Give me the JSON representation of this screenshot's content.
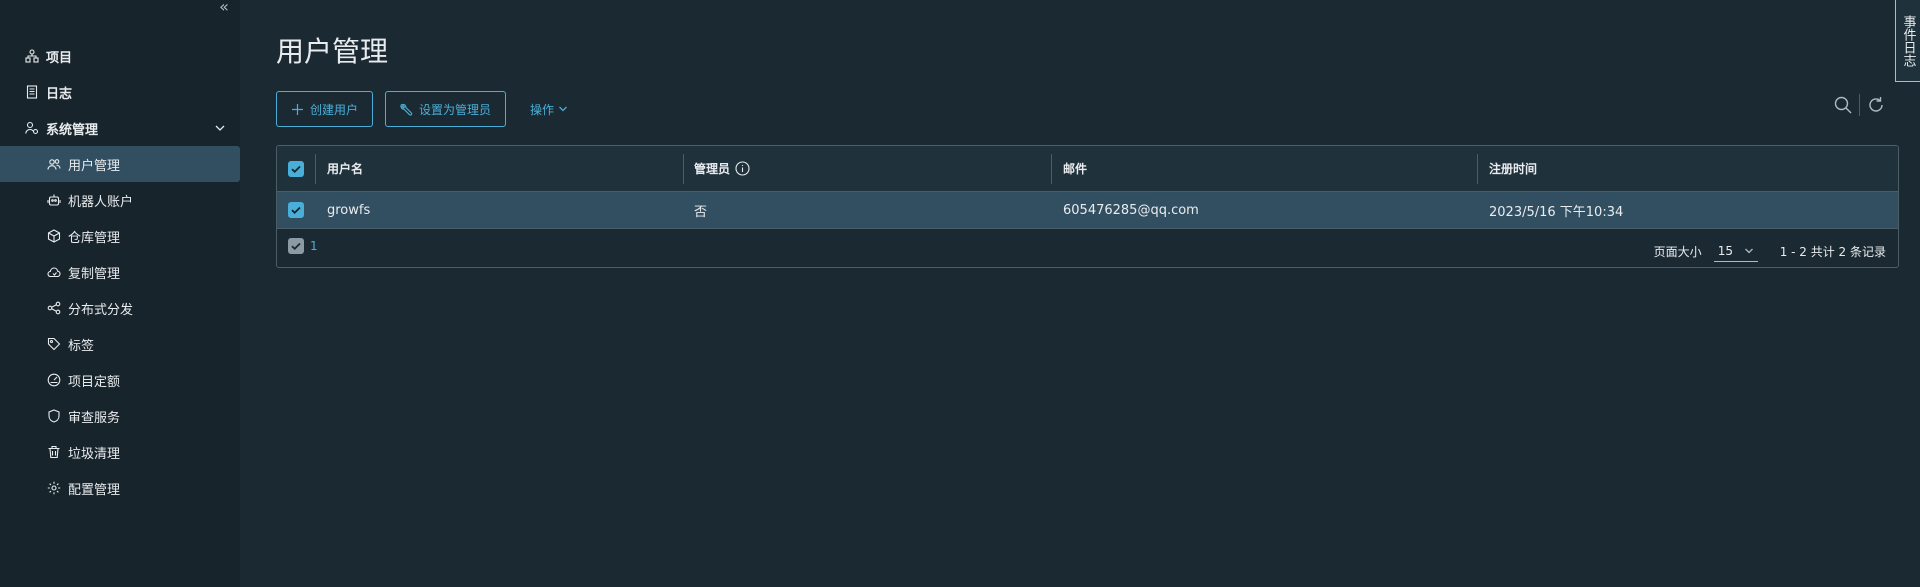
{
  "sidebar": {
    "collapse_glyph": "«",
    "items": [
      {
        "label": "项目",
        "icon": "project-icon"
      },
      {
        "label": "日志",
        "icon": "log-icon"
      },
      {
        "label": "系统管理",
        "icon": "system-admin-icon"
      },
      {
        "label": "用户管理",
        "icon": "users-icon"
      },
      {
        "label": "机器人账户",
        "icon": "robot-icon"
      },
      {
        "label": "仓库管理",
        "icon": "registry-icon"
      },
      {
        "label": "复制管理",
        "icon": "replication-icon"
      },
      {
        "label": "分布式分发",
        "icon": "distribution-icon"
      },
      {
        "label": "标签",
        "icon": "tag-icon"
      },
      {
        "label": "项目定额",
        "icon": "quota-icon"
      },
      {
        "label": "审查服务",
        "icon": "shield-icon"
      },
      {
        "label": "垃圾清理",
        "icon": "trash-icon"
      },
      {
        "label": "配置管理",
        "icon": "gear-icon"
      }
    ]
  },
  "page": {
    "title": "用户管理"
  },
  "toolbar": {
    "create_user": "创建用户",
    "set_admin": "设置为管理员",
    "actions": "操作"
  },
  "grid": {
    "columns": [
      "用户名",
      "管理员",
      "邮件",
      "注册时间"
    ],
    "rows": [
      {
        "username": "growfs",
        "admin": "否",
        "email": "605476285@qq.com",
        "registered": "2023/5/16 下午10:34",
        "selected": true
      }
    ],
    "footer": {
      "selected_count": "1",
      "page_size_label": "页面大小",
      "page_size": "15",
      "summary": "1 - 2 共计 2 条记录"
    }
  },
  "event_tab": {
    "label": "事件日志"
  },
  "colors": {
    "accent": "#4aaed9",
    "active_row": "#324f62",
    "background": "#1b2a32",
    "sidebar": "#17242b"
  }
}
